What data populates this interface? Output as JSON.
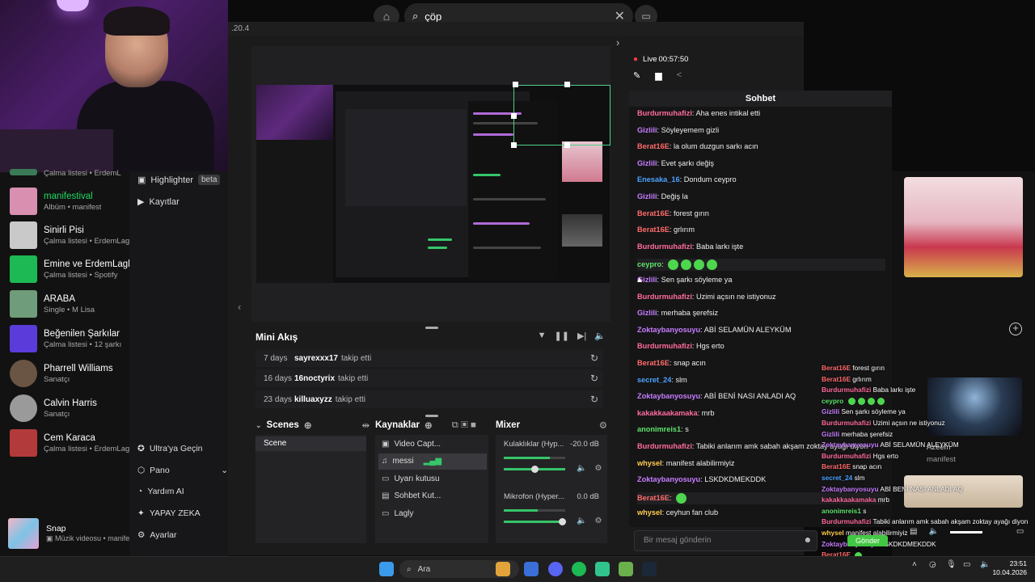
{
  "search": {
    "query": "çöp"
  },
  "window": {
    "version_text": ".20.4"
  },
  "studio_nav": {
    "highlighter_label": "Highlighter",
    "beta_label": "beta",
    "recordings_label": "Kayıtlar"
  },
  "spotify": {
    "items": [
      {
        "title": "",
        "subtitle": "Çalma listesi • ErdemL",
        "thumb": "#3b7a57"
      },
      {
        "title": "manifestival",
        "subtitle": "Albüm • manifest",
        "thumb": "#d88fb0",
        "active": true
      },
      {
        "title": "Sinirli Pisi",
        "subtitle": "Çalma listesi • ErdemLagl",
        "thumb": "#c9c9c9"
      },
      {
        "title": "Emine ve ErdemLagly",
        "subtitle": "Çalma listesi • Spotify",
        "thumb": "#1db954"
      },
      {
        "title": "ARABA",
        "subtitle": "Single • M Lisa",
        "thumb": "#6f9c7a"
      },
      {
        "title": "Beğenilen Şarkılar",
        "subtitle": "Çalma listesi • 12 şarkı",
        "thumb": "#5b3bd9"
      },
      {
        "title": "Pharrell Williams",
        "subtitle": "Sanatçı",
        "thumb": "#6a5443"
      },
      {
        "title": "Calvin Harris",
        "subtitle": "Sanatçı",
        "thumb": "#9a9a9a"
      },
      {
        "title": "Cem Karaca",
        "subtitle": "Çalma listesi • ErdemLagl",
        "thumb": "#b33a3a"
      }
    ],
    "now_playing": {
      "title": "Snap",
      "subtitle": "Müzik videosu • manifes"
    }
  },
  "mini_feed": {
    "title": "Mini Akış",
    "rows": [
      {
        "ago": "7 days",
        "user": "sayrexxx17",
        "action": "takip etti"
      },
      {
        "ago": "16 days",
        "user": "16noctyrix",
        "action": "takip etti"
      },
      {
        "ago": "23 days",
        "user": "killuaxyzz",
        "action": "takip etti"
      }
    ]
  },
  "scenes": {
    "title": "Scenes",
    "items": [
      "Scene"
    ]
  },
  "sources": {
    "title": "Kaynaklar",
    "items": [
      {
        "label": "Video Capt...",
        "icon": "camera-icon"
      },
      {
        "label": "messi",
        "icon": "music-icon",
        "selected": true
      },
      {
        "label": "Uyarı kutusu",
        "icon": "alert-icon"
      },
      {
        "label": "Sohbet Kut...",
        "icon": "chat-icon"
      },
      {
        "label": "Lagly",
        "icon": "monitor-icon"
      }
    ]
  },
  "mixer": {
    "title": "Mixer",
    "channels": [
      {
        "name": "Kulaklıklar (Hyp...",
        "db": "-20.0 dB",
        "level": 0.75,
        "volume": 0.5
      },
      {
        "name": "Mikrofon (Hyper...",
        "db": "0.0 dB",
        "level": 0.55,
        "volume": 0.95
      }
    ]
  },
  "menu": {
    "ultra": "Ultra'ya Geçin",
    "dashboard": "Pano",
    "help": "Yardım AI",
    "ai": "YAPAY ZEKA",
    "settings": "Ayarlar"
  },
  "live": {
    "label": "Live",
    "time": "00:57:50"
  },
  "chat": {
    "title": "Sohbet",
    "placeholder": "Bir mesaj gönderin",
    "messages": [
      {
        "user": "Burdurmuhafizi",
        "color": "#ff6b9e",
        "text": "Aha enes intikal etti"
      },
      {
        "user": "Gizlili",
        "color": "#c77dff",
        "text": "Söyleyemem gizli"
      },
      {
        "user": "Berat16E",
        "color": "#ff6b6b",
        "text": "la olum duzgun sarkı acın"
      },
      {
        "user": "Gizlili",
        "color": "#c77dff",
        "text": "Evet şarkı değiş"
      },
      {
        "user": "Enesaka_16",
        "color": "#4aa3ff",
        "text": "Dondum ceypro"
      },
      {
        "user": "Gizlili",
        "color": "#c77dff",
        "text": "Değiş la"
      },
      {
        "user": "Berat16E",
        "color": "#ff6b6b",
        "text": "forest gırın"
      },
      {
        "user": "Berat16E",
        "color": "#ff6b6b",
        "text": "grlırım"
      },
      {
        "user": "Burdurmuhafizi",
        "color": "#ff6b9e",
        "text": "Baba larkı işte"
      },
      {
        "user": "ceypro",
        "color": "#5ee36b",
        "text": "",
        "emotes": 4
      },
      {
        "user": "Gizlili",
        "color": "#c77dff",
        "text": "Sen şarkı söyleme ya"
      },
      {
        "user": "Burdurmuhafizi",
        "color": "#ff6b9e",
        "text": "Uzimi açsın ne istiyonuz"
      },
      {
        "user": "Gizlili",
        "color": "#c77dff",
        "text": "merhaba şerefsiz"
      },
      {
        "user": "Zoktaybanyosuyu",
        "color": "#c77dff",
        "text": "ABİ SELAMÜN ALEYKÜM"
      },
      {
        "user": "Burdurmuhafizi",
        "color": "#ff6b9e",
        "text": "Hgs erto"
      },
      {
        "user": "Berat16E",
        "color": "#ff6b6b",
        "text": "snap acın"
      },
      {
        "user": "secret_24",
        "color": "#4aa3ff",
        "text": "slm"
      },
      {
        "user": "Zoktaybanyosuyu",
        "color": "#c77dff",
        "text": "ABİ BENİ NASI ANLADI AQ"
      },
      {
        "user": "kakakkaakamaka",
        "color": "#ff6b9e",
        "text": "mrb"
      },
      {
        "user": "anonimreis1",
        "color": "#5ee36b",
        "text": "s"
      },
      {
        "user": "Burdurmuhafizi",
        "color": "#ff6b9e",
        "text": "Tabiki anlarım amk sabah akşam zoktay ayağı diyon"
      },
      {
        "user": "whysel",
        "color": "#ffcc4d",
        "text": "manifest alabilirmiyiz"
      },
      {
        "user": "Zoktaybanyosuyu",
        "color": "#c77dff",
        "text": "LSKDKDMEKDDK"
      },
      {
        "user": "Berat16E",
        "color": "#ff6b6b",
        "text": "",
        "emotes": 1
      },
      {
        "user": "whysel",
        "color": "#ffcc4d",
        "text": "ceyhun fan club"
      }
    ]
  },
  "overlay_chat": {
    "messages": [
      {
        "user": "Berat16E",
        "color": "#ff6b6b",
        "text": "forest gırın"
      },
      {
        "user": "Berat16E",
        "color": "#ff6b6b",
        "text": "grlırım"
      },
      {
        "user": "Burdurmuhafizi",
        "color": "#ff6b9e",
        "text": "Baba larkı işte"
      },
      {
        "user": "ceypro",
        "color": "#5ee36b",
        "text": "",
        "emotes": 4
      },
      {
        "user": "Gizlili",
        "color": "#c77dff",
        "text": "Sen şarkı söyleme ya"
      },
      {
        "user": "Burdurmuhafizi",
        "color": "#ff6b9e",
        "text": "Uzimi açsın ne istiyonuz"
      },
      {
        "user": "Gizlili",
        "color": "#c77dff",
        "text": "merhaba şerefsiz"
      },
      {
        "user": "Zoktaybanyosuyu",
        "color": "#c77dff",
        "text": "ABİ SELAMÜN ALEYKÜM"
      },
      {
        "user": "Burdurmuhafizi",
        "color": "#ff6b9e",
        "text": "Hgs erto"
      },
      {
        "user": "Berat16E",
        "color": "#ff6b6b",
        "text": "snap acın"
      },
      {
        "user": "secret_24",
        "color": "#4aa3ff",
        "text": "slm"
      },
      {
        "user": "Zoktaybanyosuyu",
        "color": "#c77dff",
        "text": "ABİ BENİ NASI ANLADI AQ"
      },
      {
        "user": "kakakkaakamaka",
        "color": "#ff6b9e",
        "text": "mrb"
      },
      {
        "user": "anonimreis1",
        "color": "#5ee36b",
        "text": "s"
      },
      {
        "user": "Burdurmuhafizi",
        "color": "#ff6b9e",
        "text": "Tabiki anlarım amk sabah akşam zoktay ayağı diyon"
      },
      {
        "user": "whysel",
        "color": "#ffcc4d",
        "text": "manifest alabilirmiyiz"
      },
      {
        "user": "Zoktaybanyosuyu",
        "color": "#c77dff",
        "text": "LSKDKDMEKDDK"
      },
      {
        "user": "Berat16E",
        "color": "#ff6b6b",
        "text": "",
        "emotes": 1
      },
      {
        "user": "whysel",
        "color": "#ffcc4d",
        "text": "ceyhun fan club"
      }
    ],
    "send_label": "Gönder"
  },
  "right_panel": {
    "label_azeem": "Azeem",
    "label_manifest": "manifest"
  },
  "taskbar": {
    "search_label": "Ara",
    "time": "23:51",
    "date": "10.04.2026"
  }
}
